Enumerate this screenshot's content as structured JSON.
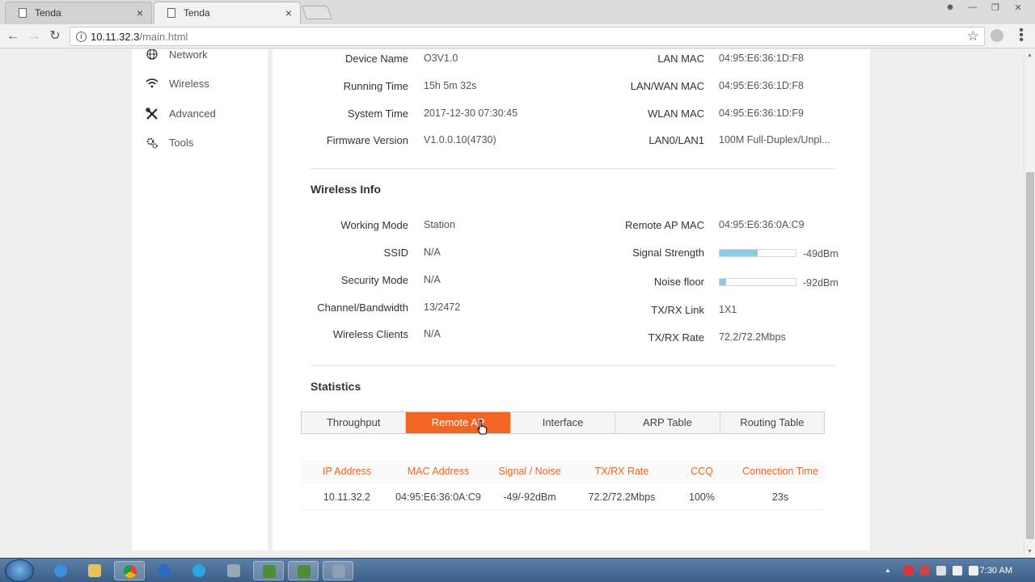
{
  "browser": {
    "tabs": [
      {
        "title": "Tenda",
        "close": "×"
      },
      {
        "title": "Tenda",
        "close": "×"
      }
    ],
    "url_host": "10.11.32.3",
    "url_path": "/main.html"
  },
  "sidebar": {
    "items": [
      {
        "label": "Network",
        "icon": "globe-icon"
      },
      {
        "label": "Wireless",
        "icon": "wifi-icon"
      },
      {
        "label": "Advanced",
        "icon": "tools-icon"
      },
      {
        "label": "Tools",
        "icon": "gear-icon"
      }
    ]
  },
  "device": {
    "left": [
      {
        "label": "Device Name",
        "value": "O3V1.0"
      },
      {
        "label": "Running Time",
        "value": "15h 5m 32s"
      },
      {
        "label": "System Time",
        "value": "2017-12-30 07:30:45"
      },
      {
        "label": "Firmware Version",
        "value": "V1.0.0.10(4730)"
      }
    ],
    "right": [
      {
        "label": "LAN MAC",
        "value": "04:95:E6:36:1D:F8"
      },
      {
        "label": "LAN/WAN MAC",
        "value": "04:95:E6:36:1D:F8"
      },
      {
        "label": "WLAN MAC",
        "value": "04:95:E6:36:1D:F9"
      },
      {
        "label": "LAN0/LAN1",
        "value": "100M Full-Duplex/Unpl..."
      }
    ]
  },
  "wireless": {
    "title": "Wireless Info",
    "left": [
      {
        "label": "Working Mode",
        "value": "Station"
      },
      {
        "label": "SSID",
        "value": "N/A"
      },
      {
        "label": "Security Mode",
        "value": "N/A"
      },
      {
        "label": "Channel/Bandwidth",
        "value": "13/2472"
      },
      {
        "label": "Wireless Clients",
        "value": "N/A"
      }
    ],
    "remote_ap_mac": {
      "label": "Remote AP MAC",
      "value": "04:95:E6:36:0A:C9"
    },
    "signal": {
      "label": "Signal Strength",
      "value": "-49dBm",
      "level": 0.5
    },
    "noise": {
      "label": "Noise floor",
      "value": "-92dBm",
      "level": 0.08
    },
    "txrx_link": {
      "label": "TX/RX Link",
      "value": "1X1"
    },
    "txrx_rate": {
      "label": "TX/RX Rate",
      "value": "72.2/72.2Mbps"
    },
    "bar_color": "#8ccbe6"
  },
  "statistics": {
    "title": "Statistics",
    "tabs": [
      "Throughput",
      "Remote AP",
      "Interface",
      "ARP Table",
      "Routing Table"
    ],
    "active_tab": "Remote AP",
    "accent": "#f26522",
    "columns": [
      "IP Address",
      "MAC Address",
      "Signal / Noise",
      "TX/RX Rate",
      "CCQ",
      "Connection Time"
    ],
    "rows": [
      [
        "10.11.32.2",
        "04:95:E6:36:0A:C9",
        "-49/-92dBm",
        "72.2/72.2Mbps",
        "100%",
        "23s"
      ]
    ]
  },
  "taskbar": {
    "clock": "7:30 AM"
  }
}
